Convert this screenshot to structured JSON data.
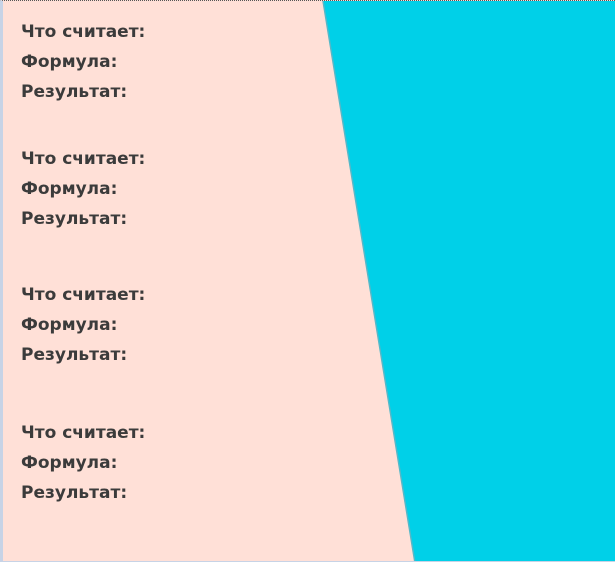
{
  "colors": {
    "background": "#ffe0d7",
    "accent": "#00d0e8",
    "text": "#3b3b3b"
  },
  "blocks": [
    {
      "what_label": "Что считает:",
      "formula_label": "Формула:",
      "result_label": "Результат:"
    },
    {
      "what_label": "Что считает:",
      "formula_label": "Формула:",
      "result_label": "Результат:"
    },
    {
      "what_label": "Что считает:",
      "formula_label": "Формула:",
      "result_label": "Результат:"
    },
    {
      "what_label": "Что считает:",
      "formula_label": "Формула:",
      "result_label": "Результат:"
    }
  ]
}
